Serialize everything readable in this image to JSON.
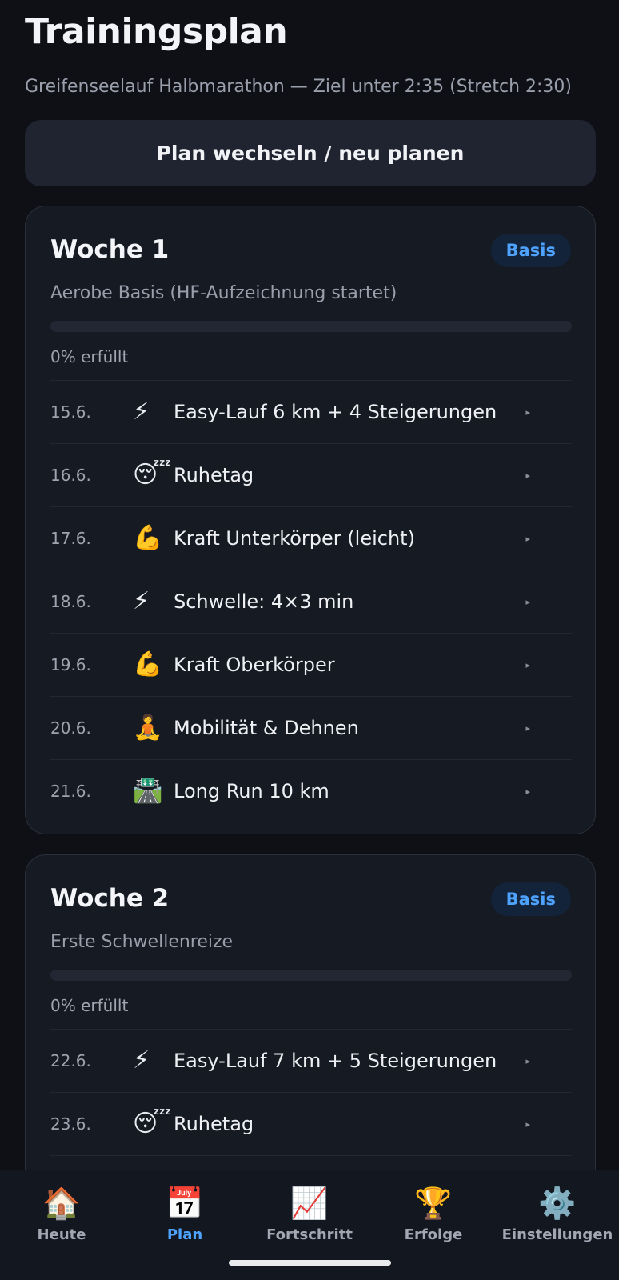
{
  "header": {
    "title": "Trainingsplan",
    "subtitle": "Greifenseelauf Halbmarathon — Ziel unter 2:35 (Stretch 2:30)"
  },
  "plan_button": {
    "label": "Plan wechseln / neu planen"
  },
  "colors": {
    "accent": "#4ea3ff",
    "background": "#0e1016",
    "card": "#161a23"
  },
  "weeks": [
    {
      "title": "Woche 1",
      "phase": "Basis",
      "description": "Aerobe Basis (HF-Aufzeichnung startet)",
      "progress_percent": 0,
      "progress_label": "0% erfüllt",
      "days": [
        {
          "date": "15.6.",
          "icon": "⚡",
          "icon_name": "lightning-icon",
          "title": "Easy-Lauf 6 km + 4 Steigerungen"
        },
        {
          "date": "16.6.",
          "icon": "😴",
          "icon_name": "sleeping-face-icon",
          "title": "Ruhetag"
        },
        {
          "date": "17.6.",
          "icon": "💪",
          "icon_name": "flexed-biceps-icon",
          "title": "Kraft Unterkörper (leicht)"
        },
        {
          "date": "18.6.",
          "icon": "⚡",
          "icon_name": "lightning-icon",
          "title": "Schwelle: 4×3 min"
        },
        {
          "date": "19.6.",
          "icon": "💪",
          "icon_name": "flexed-biceps-icon",
          "title": "Kraft Oberkörper"
        },
        {
          "date": "20.6.",
          "icon": "🧘",
          "icon_name": "meditation-icon",
          "title": "Mobilität & Dehnen"
        },
        {
          "date": "21.6.",
          "icon": "🛣️",
          "icon_name": "highway-icon",
          "title": "Long Run 10 km"
        }
      ]
    },
    {
      "title": "Woche 2",
      "phase": "Basis",
      "description": "Erste Schwellenreize",
      "progress_percent": 0,
      "progress_label": "0% erfüllt",
      "days": [
        {
          "date": "22.6.",
          "icon": "⚡",
          "icon_name": "lightning-icon",
          "title": "Easy-Lauf 7 km + 5 Steigerungen"
        },
        {
          "date": "23.6.",
          "icon": "😴",
          "icon_name": "sleeping-face-icon",
          "title": "Ruhetag"
        }
      ]
    }
  ],
  "row_arrow": "▸",
  "tabs": [
    {
      "label": "Heute",
      "icon": "🏠",
      "icon_name": "home-icon",
      "active": false
    },
    {
      "label": "Plan",
      "icon": "📅",
      "icon_name": "calendar-icon",
      "active": true
    },
    {
      "label": "Fortschritt",
      "icon": "📈",
      "icon_name": "chart-increasing-icon",
      "active": false
    },
    {
      "label": "Erfolge",
      "icon": "🏆",
      "icon_name": "trophy-icon",
      "active": false
    },
    {
      "label": "Einstellungen",
      "icon": "⚙️",
      "icon_name": "gear-icon",
      "active": false
    }
  ]
}
